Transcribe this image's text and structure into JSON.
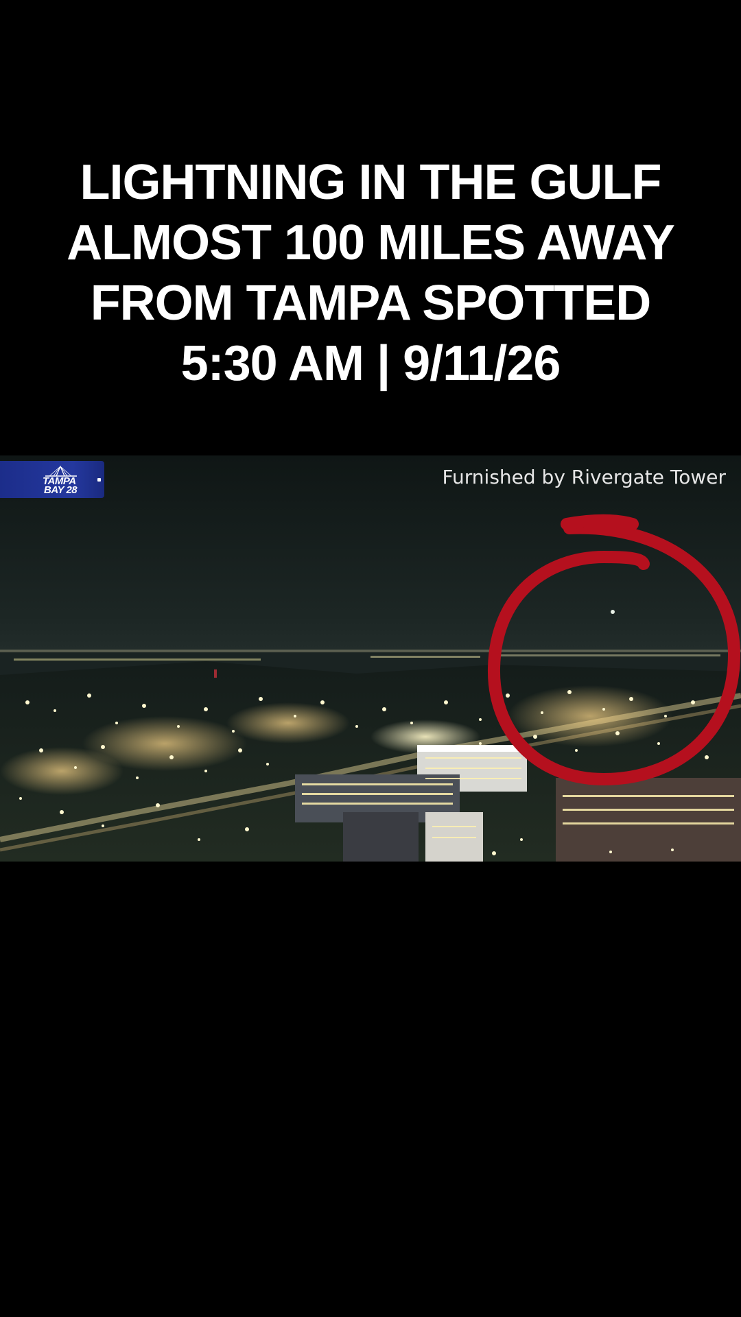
{
  "caption": {
    "line1": "LIGHTNING IN THE GULF",
    "line2": "ALMOST 100 MILES AWAY",
    "line3": "FROM TAMPA SPOTTED",
    "line4": "5:30 AM  |  9/11/26"
  },
  "video": {
    "station_logo": {
      "line1": "TAMPA",
      "line2": "BAY 28"
    },
    "credit": "Furnished by Rivergate Tower",
    "annotation_color": "#b5101e"
  }
}
